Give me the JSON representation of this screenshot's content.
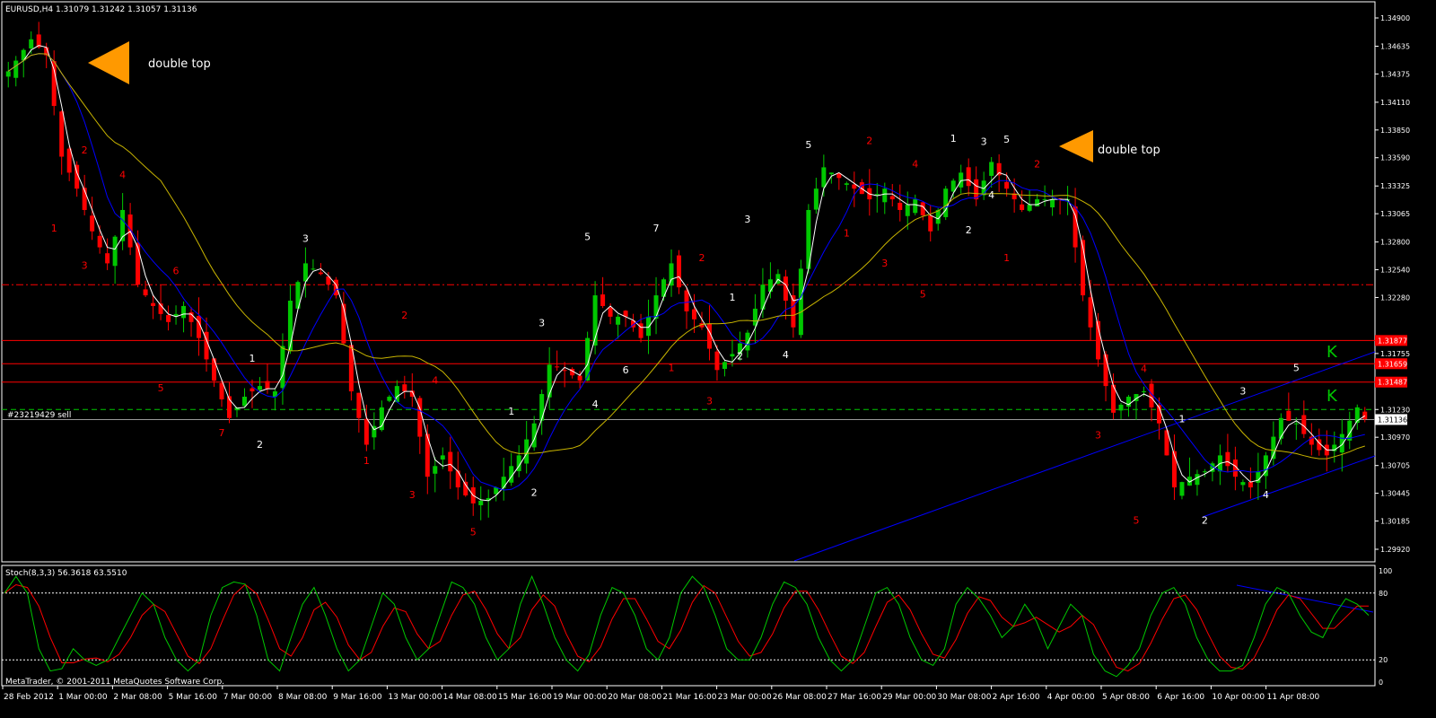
{
  "window": {
    "title": "EURUSD,H4  1.31079 1.31242 1.31057 1.31136",
    "copyright": "MetaTrader, © 2001-2011 MetaQuotes Software Corp.",
    "order_label": "#23219429 sell",
    "stoch_label": "Stoch(8,3,3) 56.3618 63.5510"
  },
  "annotations": {
    "double_top_1": "double top",
    "double_top_2": "double top",
    "k1": "K",
    "k2": "K"
  },
  "colors": {
    "background": "#000000",
    "bull": "#00c800",
    "bear": "#ff0000",
    "grid": "#ffffff",
    "ma_fast": "#ffffff",
    "ma_mid": "#0000ff",
    "ma_slow": "#c8b400",
    "hline": "#ff0000",
    "order_line": "#00c800",
    "arrow": "#ff9900",
    "stoch_main": "#00c800",
    "stoch_signal": "#ff0000",
    "label_white": "#ffffff",
    "label_red": "#ff0000",
    "k_label": "#00c800"
  },
  "chart_data": {
    "type": "candlestick",
    "symbol": "EURUSD",
    "timeframe": "H4",
    "ohlc_current": [
      1.31079,
      1.31242,
      1.31057,
      1.31136
    ],
    "ylim": [
      1.299,
      1.35
    ],
    "y_ticks": [
      "1.34900",
      "1.34635",
      "1.34375",
      "1.34110",
      "1.33850",
      "1.33590",
      "1.33325",
      "1.33065",
      "1.32800",
      "1.32540",
      "1.32280",
      "1.31755",
      "1.31230",
      "1.30970",
      "1.30705",
      "1.30445",
      "1.30185",
      "1.29920"
    ],
    "x_ticks": [
      "28 Feb 2012",
      "1 Mar 00:00",
      "2 Mar 08:00",
      "5 Mar 16:00",
      "7 Mar 00:00",
      "8 Mar 08:00",
      "9 Mar 16:00",
      "13 Mar 00:00",
      "14 Mar 08:00",
      "15 Mar 16:00",
      "19 Mar 00:00",
      "20 Mar 08:00",
      "21 Mar 16:00",
      "23 Mar 00:00",
      "26 Mar 08:00",
      "27 Mar 16:00",
      "29 Mar 00:00",
      "30 Mar 08:00",
      "2 Apr 16:00",
      "4 Apr 00:00",
      "5 Apr 08:00",
      "6 Apr 16:00",
      "10 Apr 00:00",
      "11 Apr 08:00"
    ],
    "close_path": [
      [
        0,
        1.344
      ],
      [
        3,
        1.347
      ],
      [
        5,
        1.3455
      ],
      [
        7,
        1.336
      ],
      [
        9,
        1.333
      ],
      [
        11,
        1.329
      ],
      [
        13,
        1.326
      ],
      [
        15,
        1.331
      ],
      [
        17,
        1.324
      ],
      [
        19,
        1.322
      ],
      [
        21,
        1.3205
      ],
      [
        23,
        1.322
      ],
      [
        25,
        1.319
      ],
      [
        27,
        1.315
      ],
      [
        29,
        1.3115
      ],
      [
        31,
        1.3135
      ],
      [
        33,
        1.3145
      ],
      [
        35,
        1.314
      ],
      [
        37,
        1.3225
      ],
      [
        39,
        1.326
      ],
      [
        41,
        1.325
      ],
      [
        43,
        1.323
      ],
      [
        45,
        1.314
      ],
      [
        47,
        1.309
      ],
      [
        49,
        1.3125
      ],
      [
        51,
        1.3145
      ],
      [
        53,
        1.3135
      ],
      [
        55,
        1.306
      ],
      [
        57,
        1.308
      ],
      [
        59,
        1.305
      ],
      [
        61,
        1.3035
      ],
      [
        63,
        1.304
      ],
      [
        65,
        1.306
      ],
      [
        67,
        1.308
      ],
      [
        69,
        1.311
      ],
      [
        71,
        1.3165
      ],
      [
        73,
        1.316
      ],
      [
        75,
        1.315
      ],
      [
        77,
        1.323
      ],
      [
        79,
        1.321
      ],
      [
        81,
        1.321
      ],
      [
        83,
        1.319
      ],
      [
        85,
        1.323
      ],
      [
        87,
        1.326
      ],
      [
        89,
        1.3215
      ],
      [
        91,
        1.32
      ],
      [
        93,
        1.316
      ],
      [
        95,
        1.3175
      ],
      [
        97,
        1.3195
      ],
      [
        99,
        1.324
      ],
      [
        101,
        1.325
      ],
      [
        103,
        1.32
      ],
      [
        105,
        1.331
      ],
      [
        107,
        1.335
      ],
      [
        109,
        1.334
      ],
      [
        111,
        1.333
      ],
      [
        113,
        1.332
      ],
      [
        115,
        1.333
      ],
      [
        117,
        1.331
      ],
      [
        119,
        1.332
      ],
      [
        121,
        1.329
      ],
      [
        123,
        1.333
      ],
      [
        125,
        1.3345
      ],
      [
        127,
        1.332
      ],
      [
        129,
        1.3355
      ],
      [
        131,
        1.333
      ],
      [
        133,
        1.331
      ],
      [
        135,
        1.332
      ],
      [
        137,
        1.332
      ],
      [
        139,
        1.332
      ],
      [
        141,
        1.323
      ],
      [
        143,
        1.317
      ],
      [
        145,
        1.312
      ],
      [
        147,
        1.3135
      ],
      [
        149,
        1.314
      ],
      [
        151,
        1.311
      ],
      [
        153,
        1.305
      ],
      [
        155,
        1.306
      ],
      [
        157,
        1.3065
      ],
      [
        159,
        1.308
      ],
      [
        161,
        1.306
      ],
      [
        163,
        1.305
      ],
      [
        165,
        1.308
      ],
      [
        167,
        1.3115
      ],
      [
        169,
        1.311
      ],
      [
        171,
        1.309
      ],
      [
        173,
        1.308
      ],
      [
        175,
        1.31
      ],
      [
        177,
        1.3125
      ],
      [
        178,
        1.3114
      ]
    ],
    "ma_fast_label": "white",
    "horizontal_levels": [
      {
        "value": 1.324,
        "label": "",
        "style": "dash-dot"
      },
      {
        "value": 1.31877,
        "label": "1.31877",
        "style": "solid"
      },
      {
        "value": 1.31659,
        "label": "1.31659",
        "style": "solid"
      },
      {
        "value": 1.31487,
        "label": "1.31487",
        "style": "solid"
      },
      {
        "value": 1.3123,
        "label": "",
        "style": "order-dashed"
      },
      {
        "value": 1.31136,
        "label": "1.31136",
        "style": "bid"
      }
    ],
    "wave_labels": [
      {
        "t": "2",
        "c": "red",
        "i": 10,
        "p": 1.3363
      },
      {
        "t": "4",
        "c": "red",
        "i": 15,
        "p": 1.334
      },
      {
        "t": "1",
        "c": "red",
        "i": 6,
        "p": 1.329
      },
      {
        "t": "3",
        "c": "red",
        "i": 10,
        "p": 1.3255
      },
      {
        "t": "6",
        "c": "red",
        "i": 22,
        "p": 1.325
      },
      {
        "t": "5",
        "c": "red",
        "i": 20,
        "p": 1.314
      },
      {
        "t": "7",
        "c": "red",
        "i": 28,
        "p": 1.3098
      },
      {
        "t": "2",
        "c": "white",
        "i": 33,
        "p": 1.3087
      },
      {
        "t": "1",
        "c": "white",
        "i": 32,
        "p": 1.3168
      },
      {
        "t": "3",
        "c": "white",
        "i": 39,
        "p": 1.328
      },
      {
        "t": "2",
        "c": "red",
        "i": 52,
        "p": 1.3208
      },
      {
        "t": "4",
        "c": "red",
        "i": 56,
        "p": 1.3147
      },
      {
        "t": "1",
        "c": "red",
        "i": 47,
        "p": 1.3072
      },
      {
        "t": "3",
        "c": "red",
        "i": 53,
        "p": 1.304
      },
      {
        "t": "5",
        "c": "red",
        "i": 61,
        "p": 1.3005
      },
      {
        "t": "1",
        "c": "white",
        "i": 66,
        "p": 1.3118
      },
      {
        "t": "2",
        "c": "white",
        "i": 69,
        "p": 1.3042
      },
      {
        "t": "3",
        "c": "white",
        "i": 70,
        "p": 1.3201
      },
      {
        "t": "4",
        "c": "white",
        "i": 77,
        "p": 1.3125
      },
      {
        "t": "5",
        "c": "white",
        "i": 76,
        "p": 1.3282
      },
      {
        "t": "6",
        "c": "white",
        "i": 81,
        "p": 1.3157
      },
      {
        "t": "7",
        "c": "white",
        "i": 85,
        "p": 1.329
      },
      {
        "t": "2",
        "c": "red",
        "i": 91,
        "p": 1.3262
      },
      {
        "t": "1",
        "c": "red",
        "i": 87,
        "p": 1.3159
      },
      {
        "t": "3",
        "c": "red",
        "i": 92,
        "p": 1.3128
      },
      {
        "t": "1",
        "c": "white",
        "i": 95,
        "p": 1.3225
      },
      {
        "t": "2",
        "c": "white",
        "i": 96,
        "p": 1.317
      },
      {
        "t": "3",
        "c": "white",
        "i": 97,
        "p": 1.3298
      },
      {
        "t": "4",
        "c": "white",
        "i": 102,
        "p": 1.3171
      },
      {
        "t": "5",
        "c": "white",
        "i": 105,
        "p": 1.3368
      },
      {
        "t": "2",
        "c": "red",
        "i": 113,
        "p": 1.3372
      },
      {
        "t": "1",
        "c": "red",
        "i": 110,
        "p": 1.3285
      },
      {
        "t": "3",
        "c": "red",
        "i": 115,
        "p": 1.3257
      },
      {
        "t": "4",
        "c": "red",
        "i": 119,
        "p": 1.335
      },
      {
        "t": "5",
        "c": "red",
        "i": 120,
        "p": 1.3228
      },
      {
        "t": "1",
        "c": "white",
        "i": 124,
        "p": 1.3374
      },
      {
        "t": "2",
        "c": "white",
        "i": 126,
        "p": 1.3288
      },
      {
        "t": "3",
        "c": "white",
        "i": 128,
        "p": 1.3371
      },
      {
        "t": "4",
        "c": "white",
        "i": 129,
        "p": 1.3321
      },
      {
        "t": "5",
        "c": "white",
        "i": 131,
        "p": 1.3373
      },
      {
        "t": "2",
        "c": "red",
        "i": 135,
        "p": 1.335
      },
      {
        "t": "1",
        "c": "red",
        "i": 131,
        "p": 1.3262
      },
      {
        "t": "4",
        "c": "red",
        "i": 149,
        "p": 1.3158
      },
      {
        "t": "3",
        "c": "red",
        "i": 143,
        "p": 1.3096
      },
      {
        "t": "5",
        "c": "red",
        "i": 148,
        "p": 1.3016
      },
      {
        "t": "1",
        "c": "white",
        "i": 154,
        "p": 1.3111
      },
      {
        "t": "2",
        "c": "white",
        "i": 157,
        "p": 1.3016
      },
      {
        "t": "3",
        "c": "white",
        "i": 162,
        "p": 1.3137
      },
      {
        "t": "4",
        "c": "white",
        "i": 165,
        "p": 1.304
      },
      {
        "t": "5",
        "c": "white",
        "i": 169,
        "p": 1.3159
      }
    ]
  },
  "stochastic": {
    "k_period": 8,
    "d_period": 3,
    "slowing": 3,
    "main_value": 56.3618,
    "signal_value": 63.551,
    "levels": [
      20,
      80
    ],
    "axis_labels": [
      "100",
      "80",
      "20",
      "0"
    ],
    "main": [
      80,
      95,
      80,
      30,
      10,
      12,
      30,
      20,
      15,
      20,
      40,
      60,
      80,
      70,
      40,
      20,
      10,
      20,
      60,
      85,
      90,
      88,
      60,
      20,
      10,
      40,
      70,
      85,
      60,
      30,
      10,
      20,
      50,
      80,
      70,
      40,
      20,
      30,
      60,
      90,
      85,
      70,
      40,
      20,
      30,
      70,
      95,
      70,
      40,
      20,
      10,
      25,
      60,
      85,
      80,
      60,
      30,
      20,
      40,
      80,
      95,
      85,
      60,
      30,
      20,
      20,
      40,
      70,
      90,
      85,
      70,
      40,
      20,
      10,
      20,
      50,
      80,
      85,
      70,
      40,
      20,
      15,
      30,
      70,
      85,
      75,
      60,
      40,
      50,
      70,
      55,
      30,
      50,
      70,
      60,
      25,
      10,
      5,
      15,
      30,
      60,
      80,
      85,
      70,
      40,
      20,
      10,
      10,
      15,
      40,
      70,
      85,
      80,
      60,
      45,
      40,
      60,
      75,
      70,
      60
    ]
  }
}
